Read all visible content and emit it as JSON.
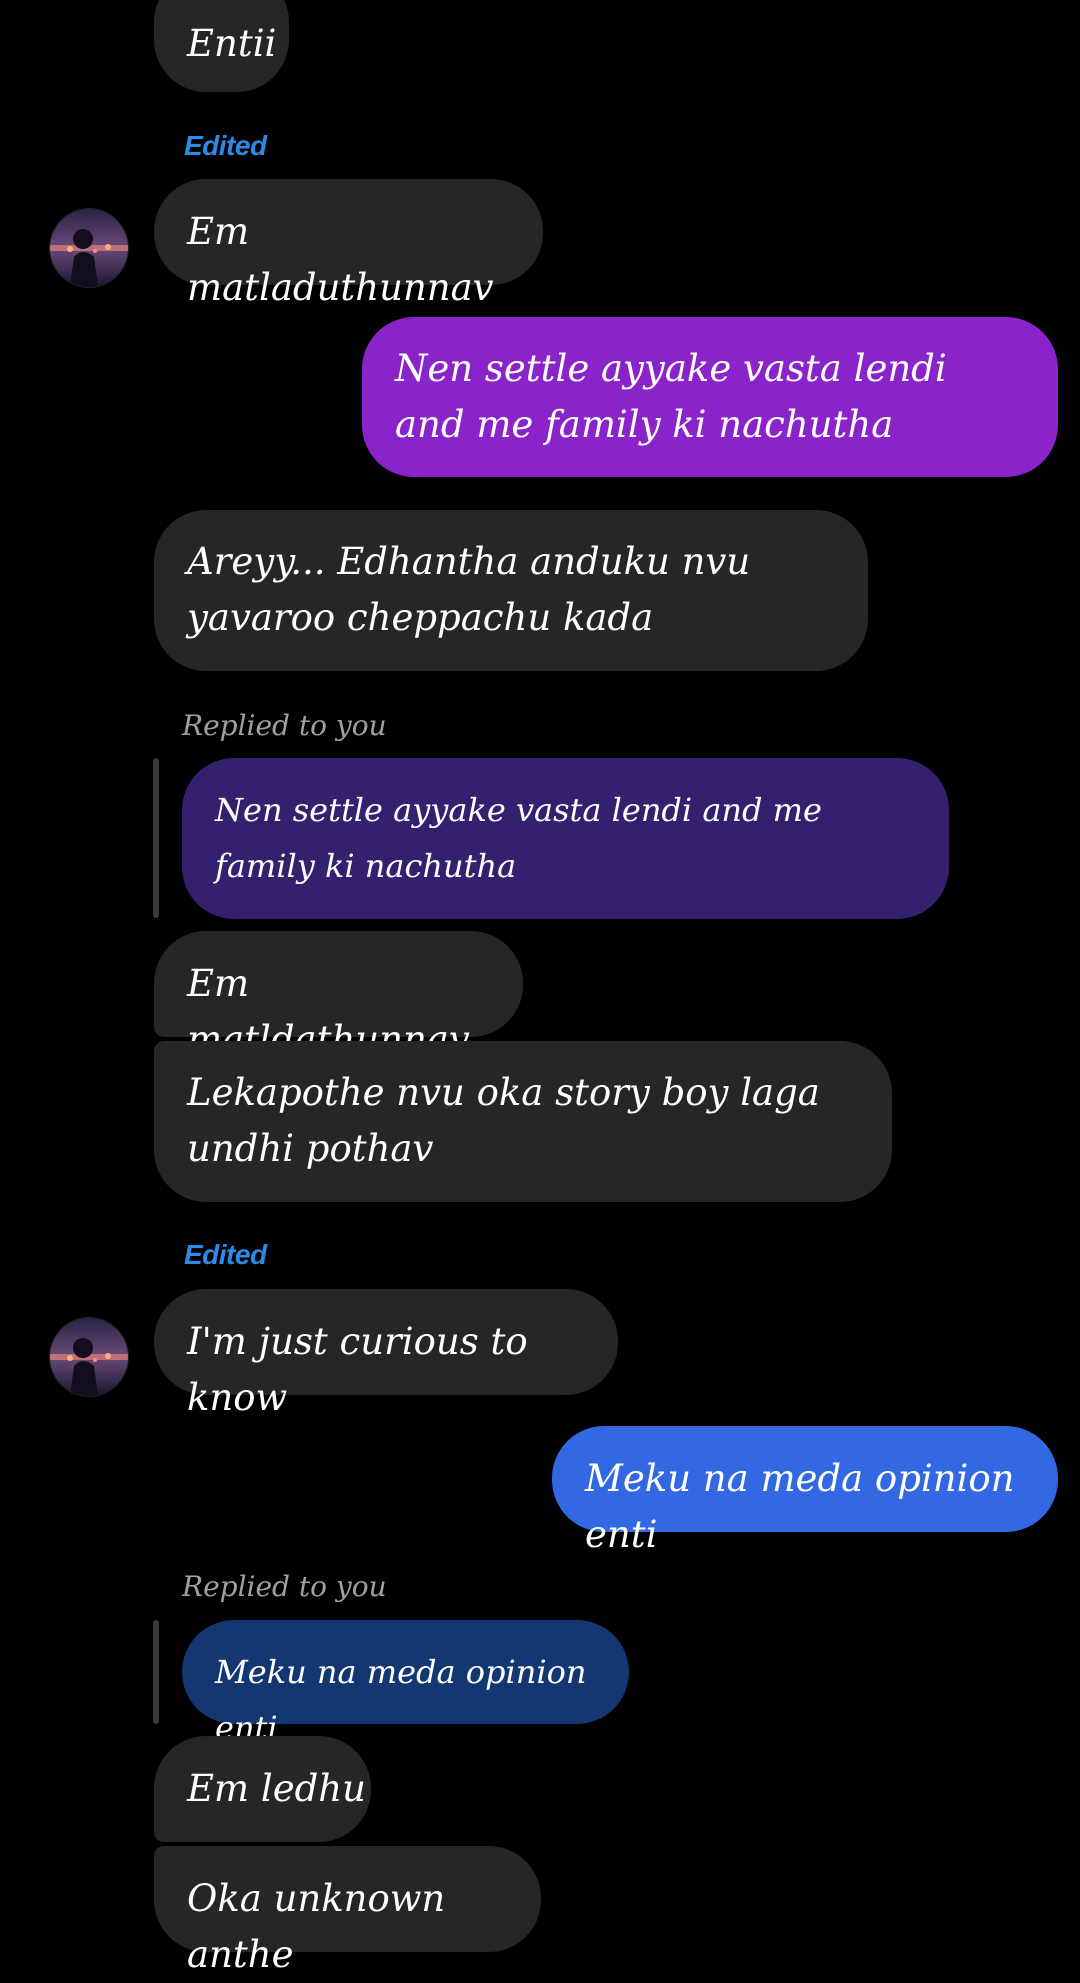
{
  "thread": {
    "edited_label": "Edited",
    "replied_label": "Replied to you",
    "messages": [
      {
        "text": "Entii"
      },
      {
        "text": "Em matladuthunnav"
      },
      {
        "text": "Nen settle ayyake vasta lendi and me family ki nachutha"
      },
      {
        "text": "Areyy... Edhantha anduku nvu yavaroo cheppachu kada"
      },
      {
        "text": "Nen settle ayyake vasta lendi and me family ki nachutha"
      },
      {
        "text": "Em matldathunnav"
      },
      {
        "text": "Lekapothe nvu oka story boy laga undhi pothav"
      },
      {
        "text": "I'm just curious to know"
      },
      {
        "text": "Meku na meda opinion enti"
      },
      {
        "text": "Meku na meda opinion enti"
      },
      {
        "text": "Em ledhu"
      },
      {
        "text": "Oka unknown anthe"
      }
    ]
  },
  "colors": {
    "background": "#000000",
    "incoming_bubble": "#262626",
    "outgoing_purple": "#8a23c9",
    "outgoing_blue": "#3268e2",
    "quote_purple": "#35206f",
    "quote_blue": "#133770",
    "edited_text": "#2a8be8"
  },
  "icons": {
    "avatar": "contact-avatar-icon"
  }
}
